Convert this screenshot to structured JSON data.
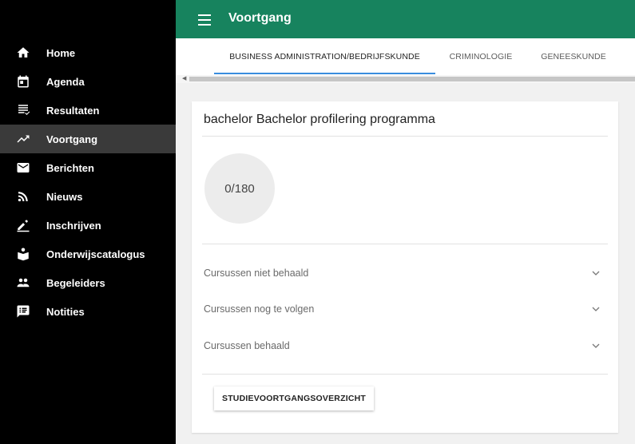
{
  "topbar": {
    "title": "Voortgang",
    "menu_icon": "hamburger-menu-icon",
    "color": "#17835e"
  },
  "sidebar": {
    "items": [
      {
        "label": "Home",
        "icon": "home-icon"
      },
      {
        "label": "Agenda",
        "icon": "calendar-icon"
      },
      {
        "label": "Resultaten",
        "icon": "results-list-icon"
      },
      {
        "label": "Voortgang",
        "icon": "trending-up-icon",
        "active": true
      },
      {
        "label": "Berichten",
        "icon": "mail-icon"
      },
      {
        "label": "Nieuws",
        "icon": "rss-icon"
      },
      {
        "label": "Inschrijven",
        "icon": "pencil-icon"
      },
      {
        "label": "Onderwijscatalogus",
        "icon": "book-reader-icon"
      },
      {
        "label": "Begeleiders",
        "icon": "people-icon"
      },
      {
        "label": "Notities",
        "icon": "note-icon"
      }
    ]
  },
  "tabs": [
    {
      "label": "BUSINESS ADMINISTRATION/BEDRIJFSKUNDE",
      "active": true
    },
    {
      "label": "CRIMINOLOGIE"
    },
    {
      "label": "GENEESKUNDE"
    }
  ],
  "card": {
    "title": "bachelor Bachelor profilering programma",
    "progress": "0/180",
    "sections": [
      {
        "label": "Cursussen niet behaald"
      },
      {
        "label": "Cursussen nog te volgen"
      },
      {
        "label": "Cursussen behaald"
      }
    ],
    "button_label": "STUDIEVOORTGANGSOVERZICHT"
  },
  "colors": {
    "accent": "#3a8dde",
    "sidebar_bg": "#000000",
    "active_item_bg": "#3a3a3a"
  }
}
